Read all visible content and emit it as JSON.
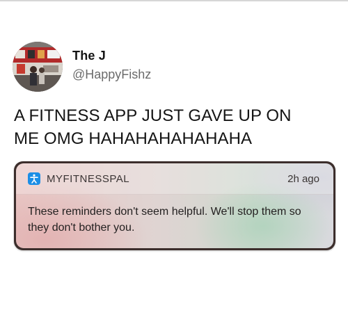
{
  "tweet": {
    "author": {
      "display_name": "The J",
      "handle": "@HappyFishz",
      "avatar_icon": "avatar-photo"
    },
    "text": "A FITNESS APP JUST GAVE UP ON\nME OMG HAHAHAHAHAHAHA"
  },
  "notification": {
    "app_name": "MYFITNESSPAL",
    "app_icon": "myfitnesspal-icon",
    "app_icon_color": "#1b8ee6",
    "time": "2h ago",
    "message": "These reminders don't seem helpful. We'll stop them so they don't bother you."
  },
  "colors": {
    "frame": "#3c2e2c",
    "text_primary": "#141414",
    "text_secondary": "#6b6b6b"
  }
}
